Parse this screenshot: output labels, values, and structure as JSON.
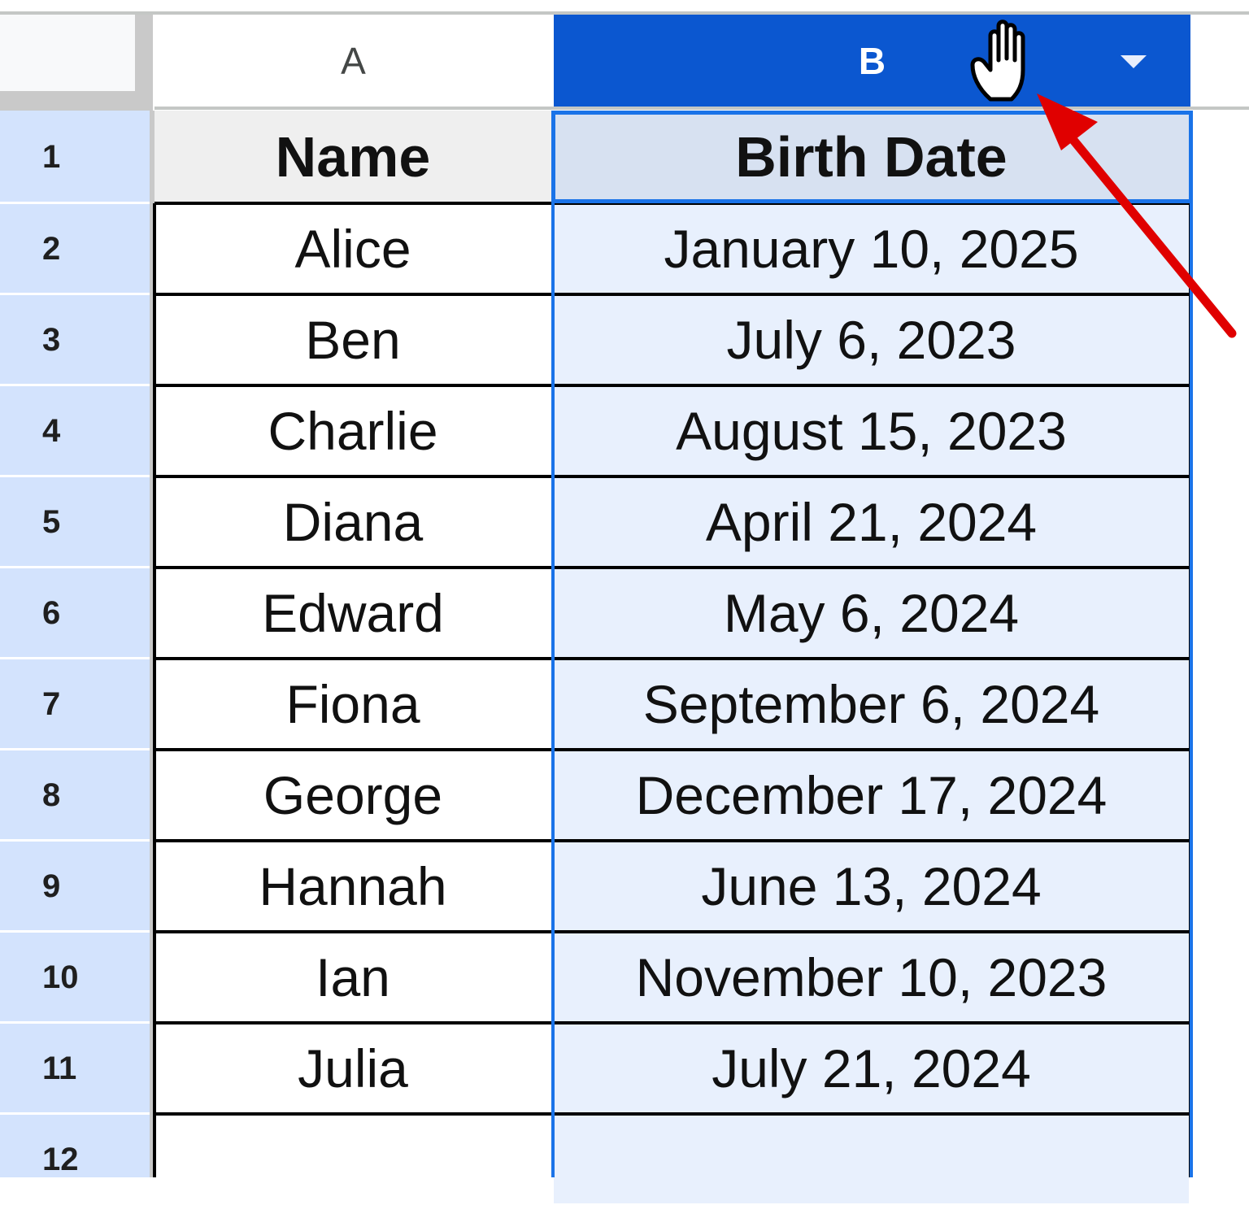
{
  "columns": {
    "a": "A",
    "b": "B"
  },
  "row_numbers": [
    "1",
    "2",
    "3",
    "4",
    "5",
    "6",
    "7",
    "8",
    "9",
    "10",
    "11",
    "12"
  ],
  "header_row": {
    "name": "Name",
    "birth_date": "Birth Date"
  },
  "rows": [
    {
      "name": "Alice",
      "birth_date": "January 10, 2025"
    },
    {
      "name": "Ben",
      "birth_date": "July 6, 2023"
    },
    {
      "name": "Charlie",
      "birth_date": "August 15, 2023"
    },
    {
      "name": "Diana",
      "birth_date": "April 21, 2024"
    },
    {
      "name": "Edward",
      "birth_date": "May 6, 2024"
    },
    {
      "name": "Fiona",
      "birth_date": "September 6, 2024"
    },
    {
      "name": "George",
      "birth_date": "December 17, 2024"
    },
    {
      "name": "Hannah",
      "birth_date": "June 13, 2024"
    },
    {
      "name": "Ian",
      "birth_date": "November 10, 2023"
    },
    {
      "name": "Julia",
      "birth_date": "July 21, 2024"
    },
    {
      "name": "",
      "birth_date": ""
    }
  ],
  "icons": {
    "cursor": "hand-cursor-icon",
    "arrow": "red-arrow-annotation",
    "dropdown": "dropdown-arrow-icon"
  },
  "colors": {
    "selected_header": "#0b57d0",
    "selection_fill": "#e8f0fd",
    "selection_border": "#1a73e8",
    "row_gutter": "#d3e3fd",
    "annotation_arrow": "#e00000"
  }
}
